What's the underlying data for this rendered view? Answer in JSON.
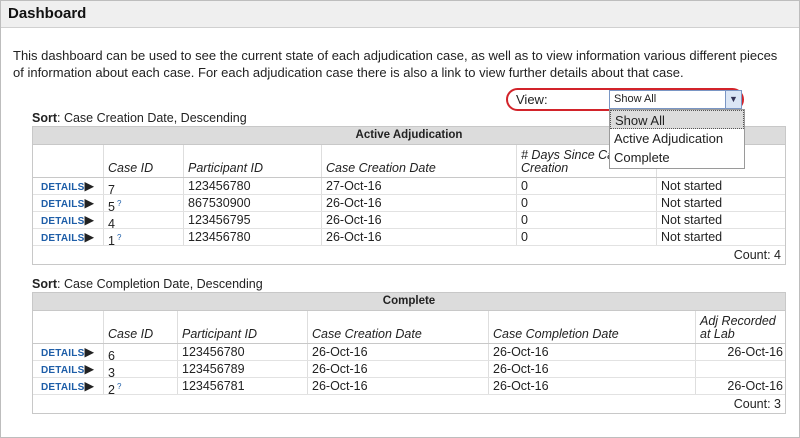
{
  "header": {
    "title": "Dashboard"
  },
  "intro": "This dashboard can be used to see the current state of each adjudication case, as well as to view information various different pieces of information about each case. For each adjudication case there is also a link to view further details about that case.",
  "view": {
    "label": "View:",
    "selected": "Show All",
    "options": [
      "Show All",
      "Active Adjudication",
      "Complete"
    ]
  },
  "active": {
    "sort_label": "Sort",
    "sort_value": ": Case Creation Date, Descending",
    "title": "Active Adjudication",
    "columns": [
      "Case ID",
      "Participant ID",
      "Case Creation Date",
      "# Days Since Case Creation",
      "Status"
    ],
    "rows": [
      {
        "details": "DETAILS",
        "case_id": "7",
        "flag": "",
        "participant": "123456780",
        "created": "27-Oct-16",
        "days": "0",
        "status": "Not started"
      },
      {
        "details": "DETAILS",
        "case_id": "5",
        "flag": "?",
        "participant": "867530900",
        "created": "26-Oct-16",
        "days": "0",
        "status": "Not started"
      },
      {
        "details": "DETAILS",
        "case_id": "4",
        "flag": "",
        "participant": "123456795",
        "created": "26-Oct-16",
        "days": "0",
        "status": "Not started"
      },
      {
        "details": "DETAILS",
        "case_id": "1",
        "flag": "?",
        "participant": "123456780",
        "created": "26-Oct-16",
        "days": "0",
        "status": "Not started"
      }
    ],
    "count": "Count: 4"
  },
  "complete": {
    "sort_label": "Sort",
    "sort_value": ": Case Completion Date, Descending",
    "title": "Complete",
    "columns": [
      "Case ID",
      "Participant ID",
      "Case Creation Date",
      "Case Completion Date",
      "Adj Recorded at Lab"
    ],
    "rows": [
      {
        "details": "DETAILS",
        "case_id": "6",
        "flag": "",
        "participant": "123456780",
        "created": "26-Oct-16",
        "completed": "26-Oct-16",
        "recorded": "26-Oct-16"
      },
      {
        "details": "DETAILS",
        "case_id": "3",
        "flag": "",
        "participant": "123456789",
        "created": "26-Oct-16",
        "completed": "26-Oct-16",
        "recorded": ""
      },
      {
        "details": "DETAILS",
        "case_id": "2",
        "flag": "?",
        "participant": "123456781",
        "created": "26-Oct-16",
        "completed": "26-Oct-16",
        "recorded": "26-Oct-16"
      }
    ],
    "count": "Count: 3"
  }
}
